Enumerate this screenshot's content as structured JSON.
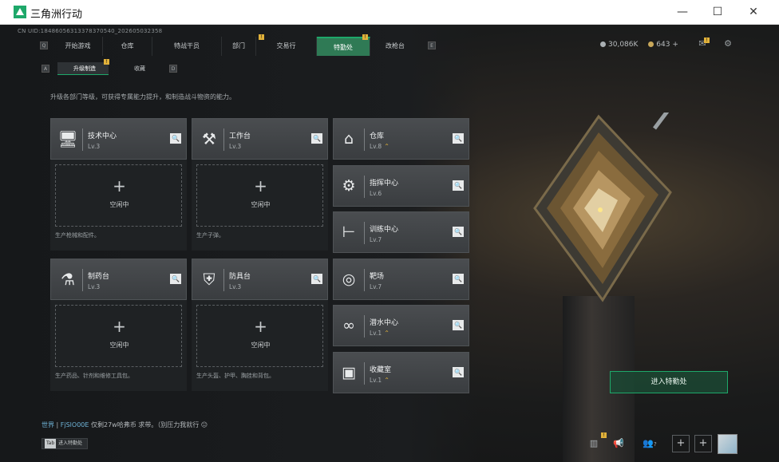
{
  "window": {
    "title": "三角洲行动",
    "minimize": "—",
    "maximize": "☐",
    "close": "✕"
  },
  "uid": "CN UID:18486056313378370540_202605032358",
  "nav": {
    "left_key": "Q",
    "right_key": "E",
    "tabs": [
      {
        "label": "开始游戏",
        "badge": ""
      },
      {
        "label": "仓库",
        "badge": ""
      },
      {
        "label": "特战干员",
        "badge": ""
      },
      {
        "label": "部门",
        "badge": "!"
      },
      {
        "label": "交易行",
        "badge": ""
      },
      {
        "label": "特勤处",
        "badge": "!"
      },
      {
        "label": "改枪台",
        "badge": ""
      }
    ]
  },
  "currency": {
    "silver": "30,086K",
    "gold": "643",
    "add": "+"
  },
  "subnav": {
    "left_key": "A",
    "right_key": "D",
    "items": [
      {
        "label": "升级制造",
        "badge": "!"
      },
      {
        "label": "收藏"
      }
    ]
  },
  "description": "升级各部门等级，可获得专属能力提升，和制造战斗物资的能力。",
  "left_facilities": [
    {
      "name": "技术中心",
      "level": "Lv.3",
      "icon": "monitor-icon",
      "glyph": "🖥",
      "idle": "空闲中",
      "note": "生产枪械和配件。"
    },
    {
      "name": "工作台",
      "level": "Lv.3",
      "icon": "tools-icon",
      "glyph": "⚒",
      "idle": "空闲中",
      "note": "生产子弹。"
    },
    {
      "name": "制药台",
      "level": "Lv.3",
      "icon": "medicine-icon",
      "glyph": "⚗",
      "idle": "空闲中",
      "note": "生产药品、针剂和维修工具包。"
    },
    {
      "name": "防具台",
      "level": "Lv.3",
      "icon": "armor-icon",
      "glyph": "⛨",
      "idle": "空闲中",
      "note": "生产头盔、护甲、胸挂和背包。"
    }
  ],
  "right_facilities": [
    {
      "name": "仓库",
      "level": "Lv.8",
      "upgrade": "⌃",
      "icon": "warehouse-icon",
      "glyph": "⌂"
    },
    {
      "name": "指挥中心",
      "level": "Lv.6",
      "upgrade": "",
      "icon": "chip-icon",
      "glyph": "⚙"
    },
    {
      "name": "训练中心",
      "level": "Lv.7",
      "upgrade": "",
      "icon": "dumbbell-icon",
      "glyph": "⊢"
    },
    {
      "name": "靶场",
      "level": "Lv.7",
      "upgrade": "",
      "icon": "target-icon",
      "glyph": "◎"
    },
    {
      "name": "潜水中心",
      "level": "Lv.1",
      "upgrade": "⌃",
      "icon": "diving-icon",
      "glyph": "∞"
    },
    {
      "name": "收藏室",
      "level": "Lv.1",
      "upgrade": "⌃",
      "icon": "collection-icon",
      "glyph": "▣"
    }
  ],
  "magnifier": "🔍",
  "plus": "+",
  "enter_button": "进入特勤处",
  "chat": {
    "channel": "世界",
    "player": "FjSlO00E",
    "message": "仅剩27w哈弗币 求带。（别压力我就行",
    "emoji": "😐"
  },
  "tab_key": {
    "key": "Tab",
    "label": "进入特勤处"
  },
  "bottom": {
    "chart_icon": "▥",
    "megaphone_icon": "📢",
    "friends_icon": "👥",
    "friends_count": "?",
    "add1": "+",
    "add2": "+"
  },
  "header_icons": {
    "mail": "✉",
    "mail_badge": "!",
    "settings": "⚙"
  }
}
